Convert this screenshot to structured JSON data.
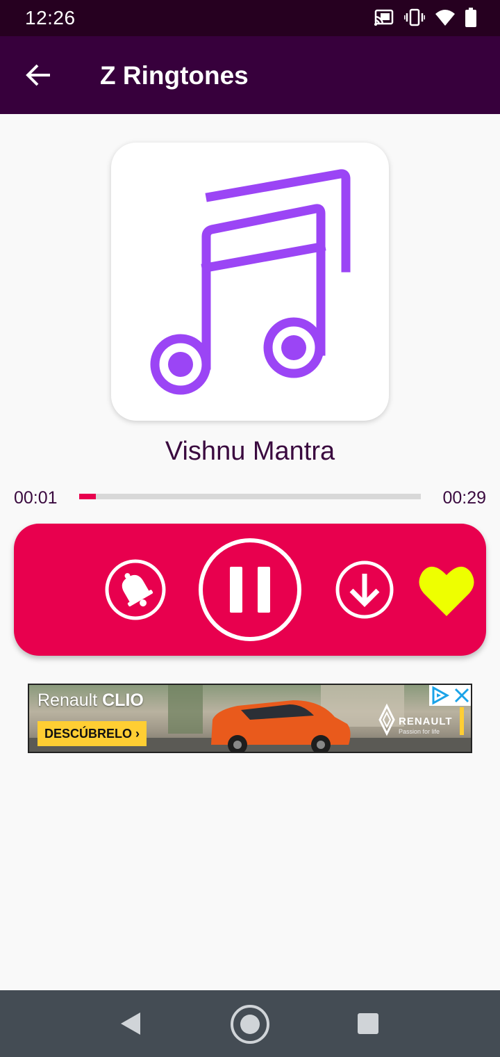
{
  "status_bar": {
    "time": "12:26",
    "icons": [
      "cast-icon",
      "vibrate-icon",
      "wifi-icon",
      "battery-icon"
    ]
  },
  "app_bar": {
    "title": "Z Ringtones",
    "back_icon": "arrow-back-icon"
  },
  "player": {
    "artwork_icon": "music-notes-icon",
    "track_title": "Vishnu Mantra",
    "current_time": "00:01",
    "total_time": "00:29",
    "progress_fraction": 0.034,
    "controls": [
      {
        "name": "set-ringtone-button",
        "icon": "bell-icon"
      },
      {
        "name": "pause-button",
        "icon": "pause-icon"
      },
      {
        "name": "download-button",
        "icon": "download-icon"
      },
      {
        "name": "favorite-button",
        "icon": "heart-icon"
      }
    ],
    "colors": {
      "accent": "#e8004e",
      "app_bar": "#37003c",
      "artwork": "#9b45f5",
      "favorite": "#eeff00"
    }
  },
  "ad": {
    "brand_prefix": "Renault",
    "brand_model": "CLIO",
    "cta": "DESCÚBRELO ›",
    "logo_text": "RENAULT",
    "tagline": "Passion for life"
  },
  "nav_bar": {
    "buttons": [
      "back-triangle-icon",
      "home-circle-icon",
      "recents-square-icon"
    ]
  }
}
